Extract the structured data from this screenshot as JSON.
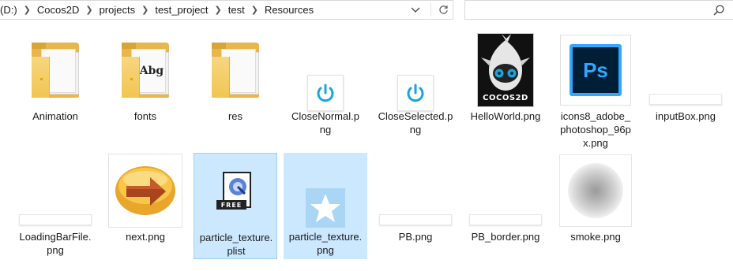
{
  "address_bar": {
    "crumbs": [
      "(D:)",
      "Cocos2D",
      "projects",
      "test_project",
      "test",
      "Resources"
    ],
    "search_placeholder": ""
  },
  "icons": {
    "dropdown": "chevron-down-icon",
    "refresh": "refresh-icon",
    "search": "search-icon"
  },
  "files": [
    {
      "name_lines": [
        "Animation"
      ],
      "type": "folder"
    },
    {
      "name_lines": [
        "fonts"
      ],
      "type": "folder-fonts"
    },
    {
      "name_lines": [
        "res"
      ],
      "type": "folder"
    },
    {
      "name_lines": [
        "CloseNormal.p",
        "ng"
      ],
      "type": "power-icon"
    },
    {
      "name_lines": [
        "CloseSelected.p",
        "ng"
      ],
      "type": "power-icon"
    },
    {
      "name_lines": [
        "HelloWorld.png"
      ],
      "type": "cocos-image",
      "logo_text": "COCOS2D"
    },
    {
      "name_lines": [
        "icons8_adobe_",
        "photoshop_96p",
        "x.png"
      ],
      "type": "photoshop-image",
      "logo_text": "Ps"
    },
    {
      "name_lines": [
        "inputBox.png"
      ],
      "type": "bar-image"
    },
    {
      "name_lines": [
        "LoadingBarFile.",
        "png"
      ],
      "type": "bar-image"
    },
    {
      "name_lines": [
        "next.png"
      ],
      "type": "arrow-image"
    },
    {
      "name_lines": [
        "particle_texture.",
        "plist"
      ],
      "type": "plist-file",
      "selected": true,
      "focused": true,
      "badge_text": "FREE"
    },
    {
      "name_lines": [
        "particle_texture.",
        "png"
      ],
      "type": "star-image",
      "selected": true
    },
    {
      "name_lines": [
        "PB.png"
      ],
      "type": "bar-image"
    },
    {
      "name_lines": [
        "PB_border.png"
      ],
      "type": "bar-image"
    },
    {
      "name_lines": [
        "smoke.png"
      ],
      "type": "smoke-image"
    }
  ],
  "colors": {
    "selection": "#cce8ff",
    "selection_border": "#99d1ff",
    "folder": "#f1c552",
    "power_blue": "#1aa6d6",
    "photoshop_blue": "#31a8ff",
    "photoshop_bg": "#001e36"
  }
}
